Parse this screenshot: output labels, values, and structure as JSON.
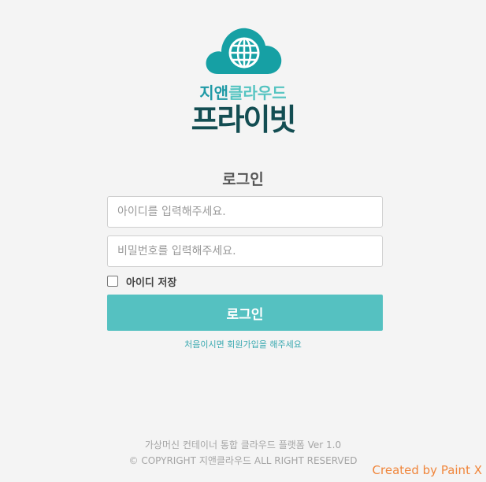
{
  "brand": {
    "line1_part1": "지앤",
    "line1_part2": "클라우드",
    "line2": "프라이빗"
  },
  "login": {
    "title": "로그인",
    "id_placeholder": "아이디를 입력해주세요.",
    "pw_placeholder": "비밀번호를 입력해주세요.",
    "remember_label": "아이디 저장",
    "remember_checked": false,
    "button_label": "로그인",
    "signup_text": "처음이시면 회원가입을 해주세요"
  },
  "footer": {
    "line1": "가상머신 컨테이너 통합 클라우드 플랫폼 Ver 1.0",
    "line2": "© COPYRIGHT 지앤클라우드 ALL RIGHT RESERVED"
  },
  "watermark": "Created by Paint X",
  "colors": {
    "accent": "#55c1c1",
    "brand_dark": "#134d52",
    "brand_teal": "#1f9aa6",
    "link": "#3aa9b0"
  },
  "icons": {
    "logo": "cloud-globe-icon"
  }
}
